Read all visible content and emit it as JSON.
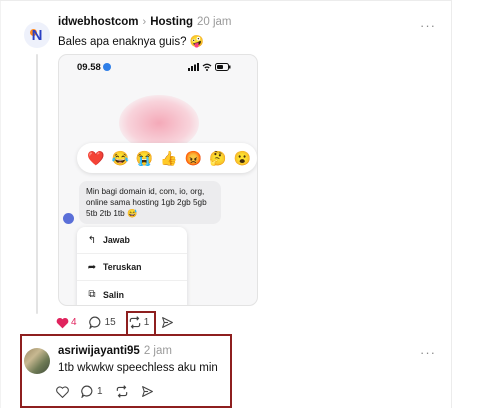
{
  "post": {
    "username": "idwebhostcom",
    "separator": "›",
    "community": "Hosting",
    "timestamp": "20 jam",
    "text": "Bales apa enaknya guis? 🤪",
    "more": "···"
  },
  "screenshot": {
    "time": "09.58",
    "signal": "..ıl",
    "wifi": "ᯤ",
    "reactions": [
      "❤️",
      "😂",
      "😭",
      "👍",
      "😡",
      "🤔",
      "😮"
    ],
    "message": "Min bagi domain id, com, io, org, online sama hosting 1gb 2gb 5gb 5tb 2tb 1tb 😅",
    "menu": [
      {
        "icon": "reply-icon",
        "glyph": "↰",
        "label": "Jawab"
      },
      {
        "icon": "forward-icon",
        "glyph": "➦",
        "label": "Teruskan"
      },
      {
        "icon": "copy-icon",
        "glyph": "⧉",
        "label": "Salin"
      }
    ]
  },
  "post_actions": {
    "likes": "4",
    "comments": "15",
    "reposts": "1"
  },
  "reply": {
    "username": "asriwijayanti95",
    "timestamp": "2 jam",
    "text": "1tb wkwkw speechless aku min",
    "more": "···",
    "comments": "1"
  },
  "colors": {
    "like_red": "#e0245e",
    "highlight_box": "#8e1f1f",
    "verified_blue": "#2f7fe8"
  }
}
